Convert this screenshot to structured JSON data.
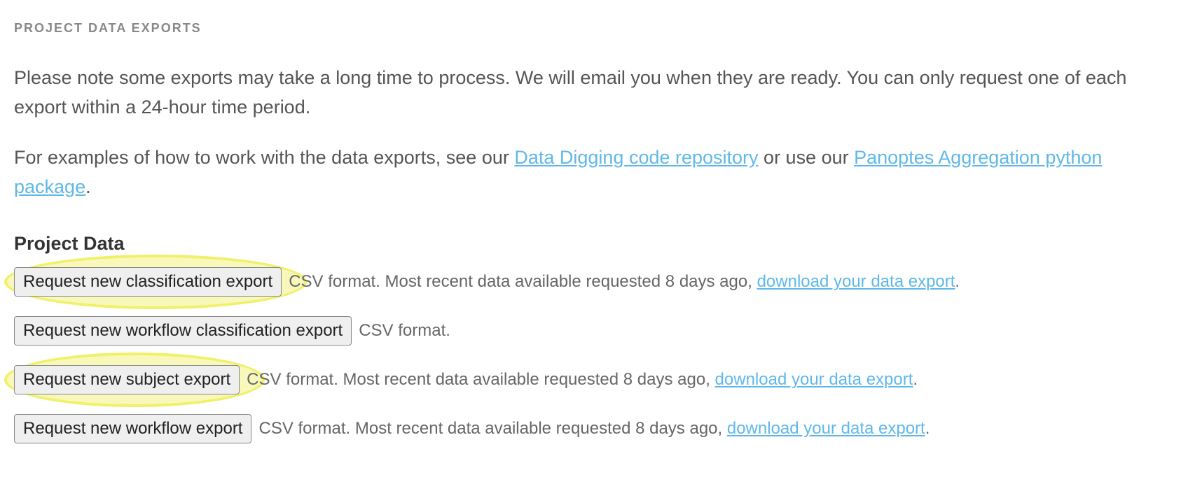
{
  "section": {
    "title": "PROJECT DATA EXPORTS",
    "description1": "Please note some exports may take a long time to process. We will email you when they are ready. You can only request one of each export within a 24-hour time period.",
    "description2_prefix": "For examples of how to work with the data exports, see our ",
    "link1": "Data Digging code repository",
    "description2_middle": " or use our ",
    "link2": "Panoptes Aggregation python package",
    "description2_suffix": ".",
    "subsection_title": "Project Data"
  },
  "exports": {
    "classification": {
      "button": "Request new classification export",
      "desc_prefix": " CSV format. Most recent data available requested 8 days ago, ",
      "link": "download your data export",
      "desc_suffix": "."
    },
    "workflow_classification": {
      "button": "Request new workflow classification export",
      "desc": " CSV format."
    },
    "subject": {
      "button": "Request new subject export",
      "desc_prefix": " CSV format. Most recent data available requested 8 days ago, ",
      "link": "download your data export",
      "desc_suffix": "."
    },
    "workflow": {
      "button": "Request new workflow export",
      "desc_prefix": " CSV format. Most recent data available requested 8 days ago, ",
      "link": "download your data export",
      "desc_suffix": "."
    }
  }
}
